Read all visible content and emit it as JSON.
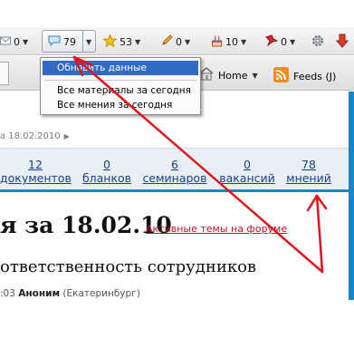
{
  "toolbar": {
    "mail_count": "0",
    "comments_count": "79",
    "star_count": "53",
    "pencil_count": "0",
    "cake_count": "10",
    "pin_count": "0"
  },
  "bookmarks": {
    "home_label": "Home",
    "feeds_label": "Feeds (J)"
  },
  "menu": {
    "items": [
      "Обновить данные",
      "Все материалы за сегодня",
      "Все мнения за сегодня"
    ]
  },
  "page": {
    "date_line": "а 18.02.2010",
    "stats": [
      {
        "number": "12",
        "label": "документов"
      },
      {
        "number": "0",
        "label": "бланков"
      },
      {
        "number": "6",
        "label": "семинаров"
      },
      {
        "number": "0",
        "label": "вакансий"
      },
      {
        "number": "78",
        "label": "мнений"
      }
    ],
    "heading": "я за 18.02.10",
    "forum_link": "Активные темы на форуме",
    "article_title": "ответственность сотрудников",
    "meta_time": ":03",
    "meta_author": "Аноним",
    "meta_city": "(Екатеринбург)"
  },
  "colors": {
    "accent_blue": "#1b84c6",
    "menu_highlight": "#316ac5",
    "annotation_red": "#e0141e"
  }
}
